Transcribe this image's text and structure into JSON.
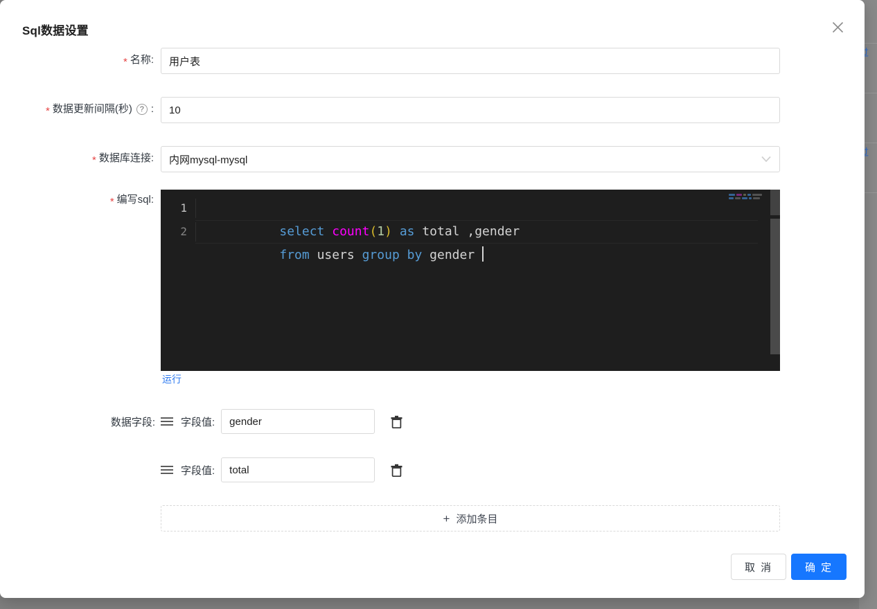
{
  "modal": {
    "title": "Sql数据设置",
    "close_icon": "close-icon"
  },
  "form": {
    "name_field": {
      "label": "名称:",
      "required_marker": "*",
      "value": "用户表",
      "placeholder": ""
    },
    "interval_field": {
      "label": "数据更新间隔(秒)",
      "required_marker": "*",
      "help_icon": "question-circle-icon",
      "colon": ":",
      "value": "10",
      "placeholder": ""
    },
    "db_connection_field": {
      "label": "数据库连接:",
      "required_marker": "*",
      "value": "内网mysql-mysql",
      "arrow_icon": "chevron-down-icon"
    },
    "sql_field": {
      "label": "编写sql:",
      "required_marker": "*",
      "run_link": "运行",
      "line_numbers": [
        "1",
        "2"
      ],
      "lines": [
        [
          {
            "t": "select",
            "c": "key"
          },
          {
            "t": " ",
            "c": "id"
          },
          {
            "t": "count",
            "c": "fn"
          },
          {
            "t": "(",
            "c": "paren"
          },
          {
            "t": "1",
            "c": "num"
          },
          {
            "t": ")",
            "c": "paren"
          },
          {
            "t": " ",
            "c": "id"
          },
          {
            "t": "as",
            "c": "key"
          },
          {
            "t": " total ,gender",
            "c": "id"
          }
        ],
        [
          {
            "t": "from",
            "c": "key"
          },
          {
            "t": " users ",
            "c": "id"
          },
          {
            "t": "group",
            "c": "key"
          },
          {
            "t": " ",
            "c": "id"
          },
          {
            "t": "by",
            "c": "key"
          },
          {
            "t": " gender ",
            "c": "id"
          }
        ]
      ],
      "plain_text": "select count(1) as total ,gender\nfrom users group by gender "
    }
  },
  "data_fields": {
    "label": "数据字段:",
    "items": [
      {
        "drag_icon": "drag-handle-icon",
        "label": "字段值:",
        "value": "gender",
        "delete_icon": "trash-icon"
      },
      {
        "drag_icon": "drag-handle-icon",
        "label": "字段值:",
        "value": "total",
        "delete_icon": "trash-icon"
      }
    ],
    "add_button": {
      "icon": "plus-icon",
      "label": "添加条目"
    }
  },
  "footer": {
    "cancel_label": "取 消",
    "confirm_label": "确 定"
  },
  "colors": {
    "primary": "#1677ff",
    "link": "#2f7bf0",
    "required": "#e64545",
    "editor_bg": "#1e1e1e",
    "keyword": "#569cd6",
    "function": "#ff00ff",
    "paren": "#d7ba2b",
    "number": "#b5cea8",
    "identifier": "#d4d4d4"
  }
}
